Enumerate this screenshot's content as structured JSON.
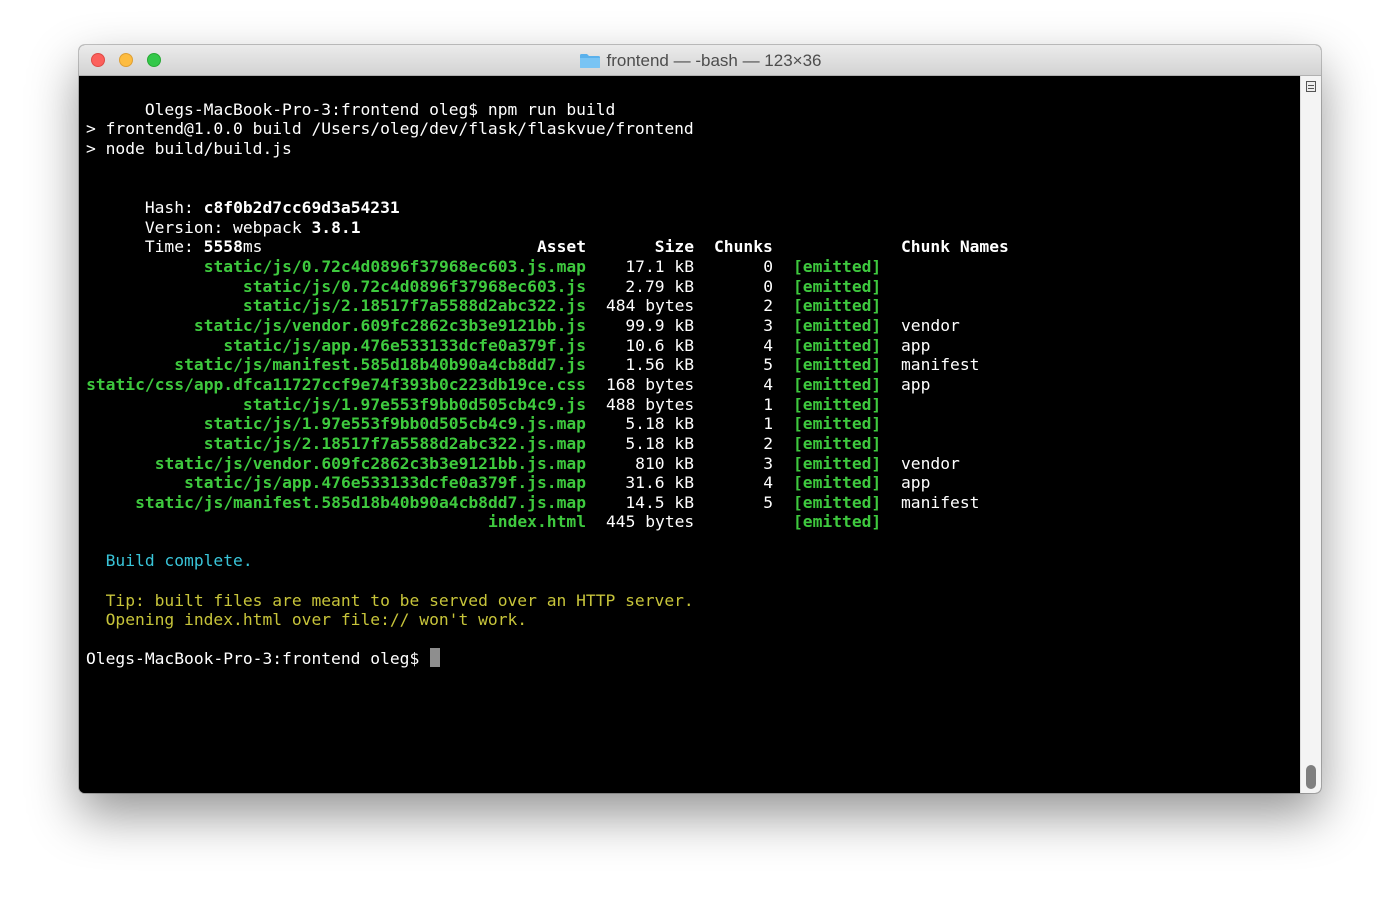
{
  "window": {
    "title": "frontend — -bash — 123×36",
    "folder_icon": "folder-icon"
  },
  "colors": {
    "background": "#000000",
    "text": "#ffffff",
    "emitted_green": "#3ec93e",
    "info_cyan": "#39c4d8",
    "tip_yellow": "#c7c43a"
  },
  "terminal": {
    "prompt": "Olegs-MacBook-Pro-3:frontend oleg$",
    "command": "npm run build",
    "script_lines": [
      "> frontend@1.0.0 build /Users/oleg/dev/flask/flaskvue/frontend",
      "> node build/build.js"
    ],
    "hash_label": "Hash:",
    "hash_value": "c8f0b2d7cc69d3a54231",
    "version_label": "Version: webpack",
    "version_value": "3.8.1",
    "time_label": "Time:",
    "time_value": "5558",
    "time_unit": "ms",
    "headers": {
      "asset": "Asset",
      "size": "Size",
      "chunks": "Chunks",
      "chunk_names": "Chunk Names"
    },
    "assets": [
      {
        "asset": "static/js/0.72c4d0896f37968ec603.js.map",
        "size": "17.1 kB",
        "chunks": "0",
        "status": "[emitted]",
        "names": ""
      },
      {
        "asset": "static/js/0.72c4d0896f37968ec603.js",
        "size": "2.79 kB",
        "chunks": "0",
        "status": "[emitted]",
        "names": ""
      },
      {
        "asset": "static/js/2.18517f7a5588d2abc322.js",
        "size": "484 bytes",
        "chunks": "2",
        "status": "[emitted]",
        "names": ""
      },
      {
        "asset": "static/js/vendor.609fc2862c3b3e9121bb.js",
        "size": "99.9 kB",
        "chunks": "3",
        "status": "[emitted]",
        "names": "vendor"
      },
      {
        "asset": "static/js/app.476e533133dcfe0a379f.js",
        "size": "10.6 kB",
        "chunks": "4",
        "status": "[emitted]",
        "names": "app"
      },
      {
        "asset": "static/js/manifest.585d18b40b90a4cb8dd7.js",
        "size": "1.56 kB",
        "chunks": "5",
        "status": "[emitted]",
        "names": "manifest"
      },
      {
        "asset": "static/css/app.dfca11727ccf9e74f393b0c223db19ce.css",
        "size": "168 bytes",
        "chunks": "4",
        "status": "[emitted]",
        "names": "app"
      },
      {
        "asset": "static/js/1.97e553f9bb0d505cb4c9.js",
        "size": "488 bytes",
        "chunks": "1",
        "status": "[emitted]",
        "names": ""
      },
      {
        "asset": "static/js/1.97e553f9bb0d505cb4c9.js.map",
        "size": "5.18 kB",
        "chunks": "1",
        "status": "[emitted]",
        "names": ""
      },
      {
        "asset": "static/js/2.18517f7a5588d2abc322.js.map",
        "size": "5.18 kB",
        "chunks": "2",
        "status": "[emitted]",
        "names": ""
      },
      {
        "asset": "static/js/vendor.609fc2862c3b3e9121bb.js.map",
        "size": "810 kB",
        "chunks": "3",
        "status": "[emitted]",
        "names": "vendor"
      },
      {
        "asset": "static/js/app.476e533133dcfe0a379f.js.map",
        "size": "31.6 kB",
        "chunks": "4",
        "status": "[emitted]",
        "names": "app"
      },
      {
        "asset": "static/js/manifest.585d18b40b90a4cb8dd7.js.map",
        "size": "14.5 kB",
        "chunks": "5",
        "status": "[emitted]",
        "names": "manifest"
      },
      {
        "asset": "index.html",
        "size": "445 bytes",
        "chunks": "",
        "status": "[emitted]",
        "names": ""
      }
    ],
    "build_complete": "  Build complete.",
    "tip_lines": [
      "  Tip: built files are meant to be served over an HTTP server.",
      "  Opening index.html over file:// won't work."
    ]
  }
}
